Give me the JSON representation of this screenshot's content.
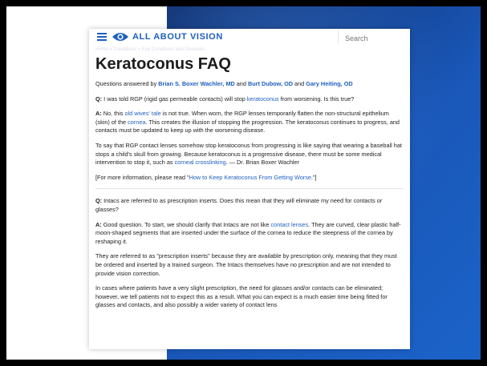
{
  "colors": {
    "brand": "#1f5fbf",
    "slide_band": "#1a57b8",
    "text": "#222222"
  },
  "header": {
    "logo_text": "ALL ABOUT VISION",
    "search_placeholder": "Search"
  },
  "breadcrumb": "Home » Conditions » Eye Conditions and Diseases",
  "title": "Keratoconus FAQ",
  "byline": {
    "prefix": "Questions answered by ",
    "author1": "Brian S. Boxer Wachler, MD",
    "sep1": " and ",
    "author2": "Burt Dubow, OD",
    "sep2": " and ",
    "author3": "Gary Heiting, OD"
  },
  "q1": {
    "label": "Q:",
    "text_before": " I was told RGP (rigid gas permeable contacts) will stop ",
    "link": "keratoconus",
    "text_after": " from worsening. Is this true?"
  },
  "a1": {
    "label": "A:",
    "t1": " No, this ",
    "link1": "old wives' tale",
    "t2": " is not true. When worn, the RGP lenses temporarily flatten the non-structural epithelium (skin) of the ",
    "link2": "cornea",
    "t3": ". This creates the illusion of stopping the progression. The keratoconus continues to progress, and contacts must be updated to keep up with the worsening disease."
  },
  "p1": {
    "t1": "To say that RGP contact lenses somehow stop keratoconus from progressing is like saying that wearing a baseball hat stops a child's skull from growing. Because keratoconus is a progressive disease, there must be some medical intervention to stop it, such as ",
    "link": "corneal crosslinking",
    "t2": ". — Dr. Brian Boxer Wachler"
  },
  "p2": {
    "t1": "[For more information, please read \"",
    "link": "How to Keep Keratoconus From Getting Worse",
    "t2": ".\"]"
  },
  "q2": {
    "label": "Q:",
    "text": " Intacs are referred to as prescription inserts. Does this mean that they will eliminate my need for contacts or glasses?"
  },
  "a2": {
    "label": "A:",
    "t1": " Good question. To start, we should clarify that Intacs are not like ",
    "link": "contact lenses",
    "t2": ". They are curved, clear plastic half-moon-shaped segments that are inserted under the surface of the cornea to reduce the steepness of the cornea by reshaping it."
  },
  "p3": "They are referred to as \"prescription inserts\" because they are available by prescription only, meaning that they must be ordered and inserted by a trained surgeon. The Intacs themselves have no prescription and are not intended to provide vision correction.",
  "p4": "In cases where patients have a very slight prescription, the need for glasses and/or contacts can be eliminated; however, we tell patients not to expect this as a result. What you can expect is a much easier time being fitted for glasses and contacts, and also possibly a wider variety of contact lens"
}
